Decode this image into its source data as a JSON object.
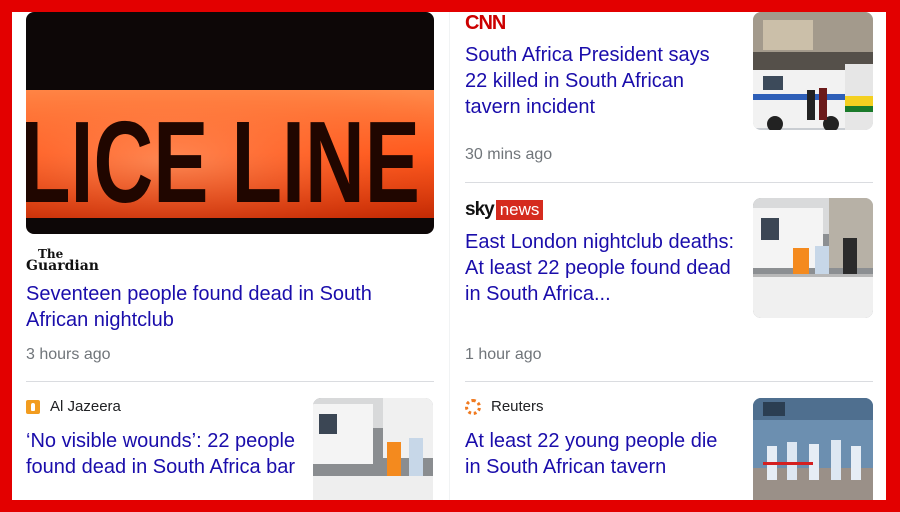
{
  "stories": [
    {
      "source": "The Guardian",
      "headline": "Seventeen people found dead in South African nightclub",
      "time": "3 hours ago",
      "image_text": "LICE LINE"
    },
    {
      "source": "CNN",
      "headline": "South Africa President says 22 killed in South African tavern incident",
      "time": "30 mins ago"
    },
    {
      "source_part1": "sky",
      "source_part2": "news",
      "headline": "East London nightclub deaths: At least 22 people found dead in South Africa...",
      "time": "1 hour ago"
    },
    {
      "source": "Al Jazeera",
      "headline": "‘No visible wounds’: 22 people found dead in South Africa bar"
    },
    {
      "source": "Reuters",
      "headline": "At least 22 young people die in South African tavern"
    }
  ],
  "colors": {
    "frame_border": "#e30000",
    "headline": "#1a0dab",
    "time": "#70757a",
    "cnn": "#cc0000",
    "sky_news_bg": "#d52b1e",
    "aljazeera": "#f29c1f"
  },
  "logos": {
    "guardian_line1": "The",
    "guardian_line2": "Guardian"
  }
}
